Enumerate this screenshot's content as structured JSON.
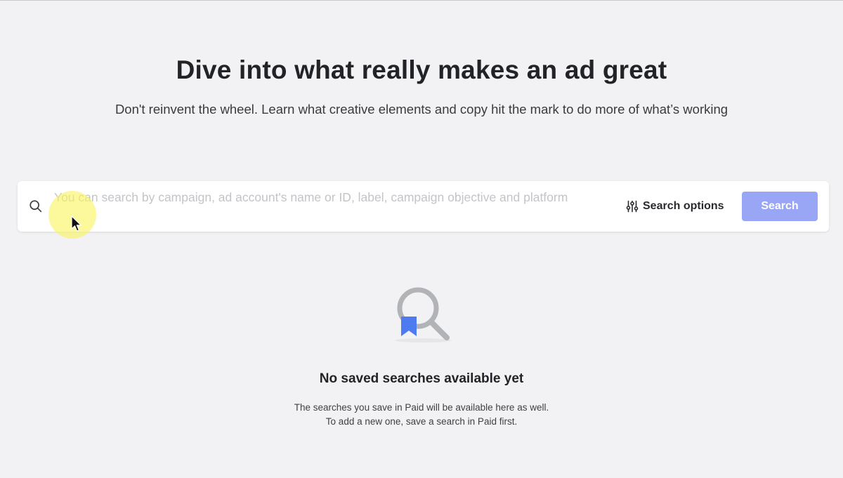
{
  "hero": {
    "title": "Dive into what really makes an ad great",
    "subtitle": "Don't reinvent the wheel. Learn what creative elements and copy hit the mark to do more of what’s working"
  },
  "search": {
    "placeholder": "You can search by campaign, ad account's name or ID, label, campaign objective and platform",
    "value": "",
    "options_label": "Search options",
    "button_label": "Search",
    "icon": "search-icon",
    "options_icon": "sliders-icon"
  },
  "empty_state": {
    "illustration_icon": "bookmark-search-icon",
    "title": "No saved searches available yet",
    "description_line1": "The searches you save in Paid will be available here as well.",
    "description_line2": "To add a new one, save a search in Paid first."
  },
  "colors": {
    "background": "#f2f2f4",
    "primary_button": "#98a6f5",
    "bookmark_accent": "#4e7cf0"
  }
}
